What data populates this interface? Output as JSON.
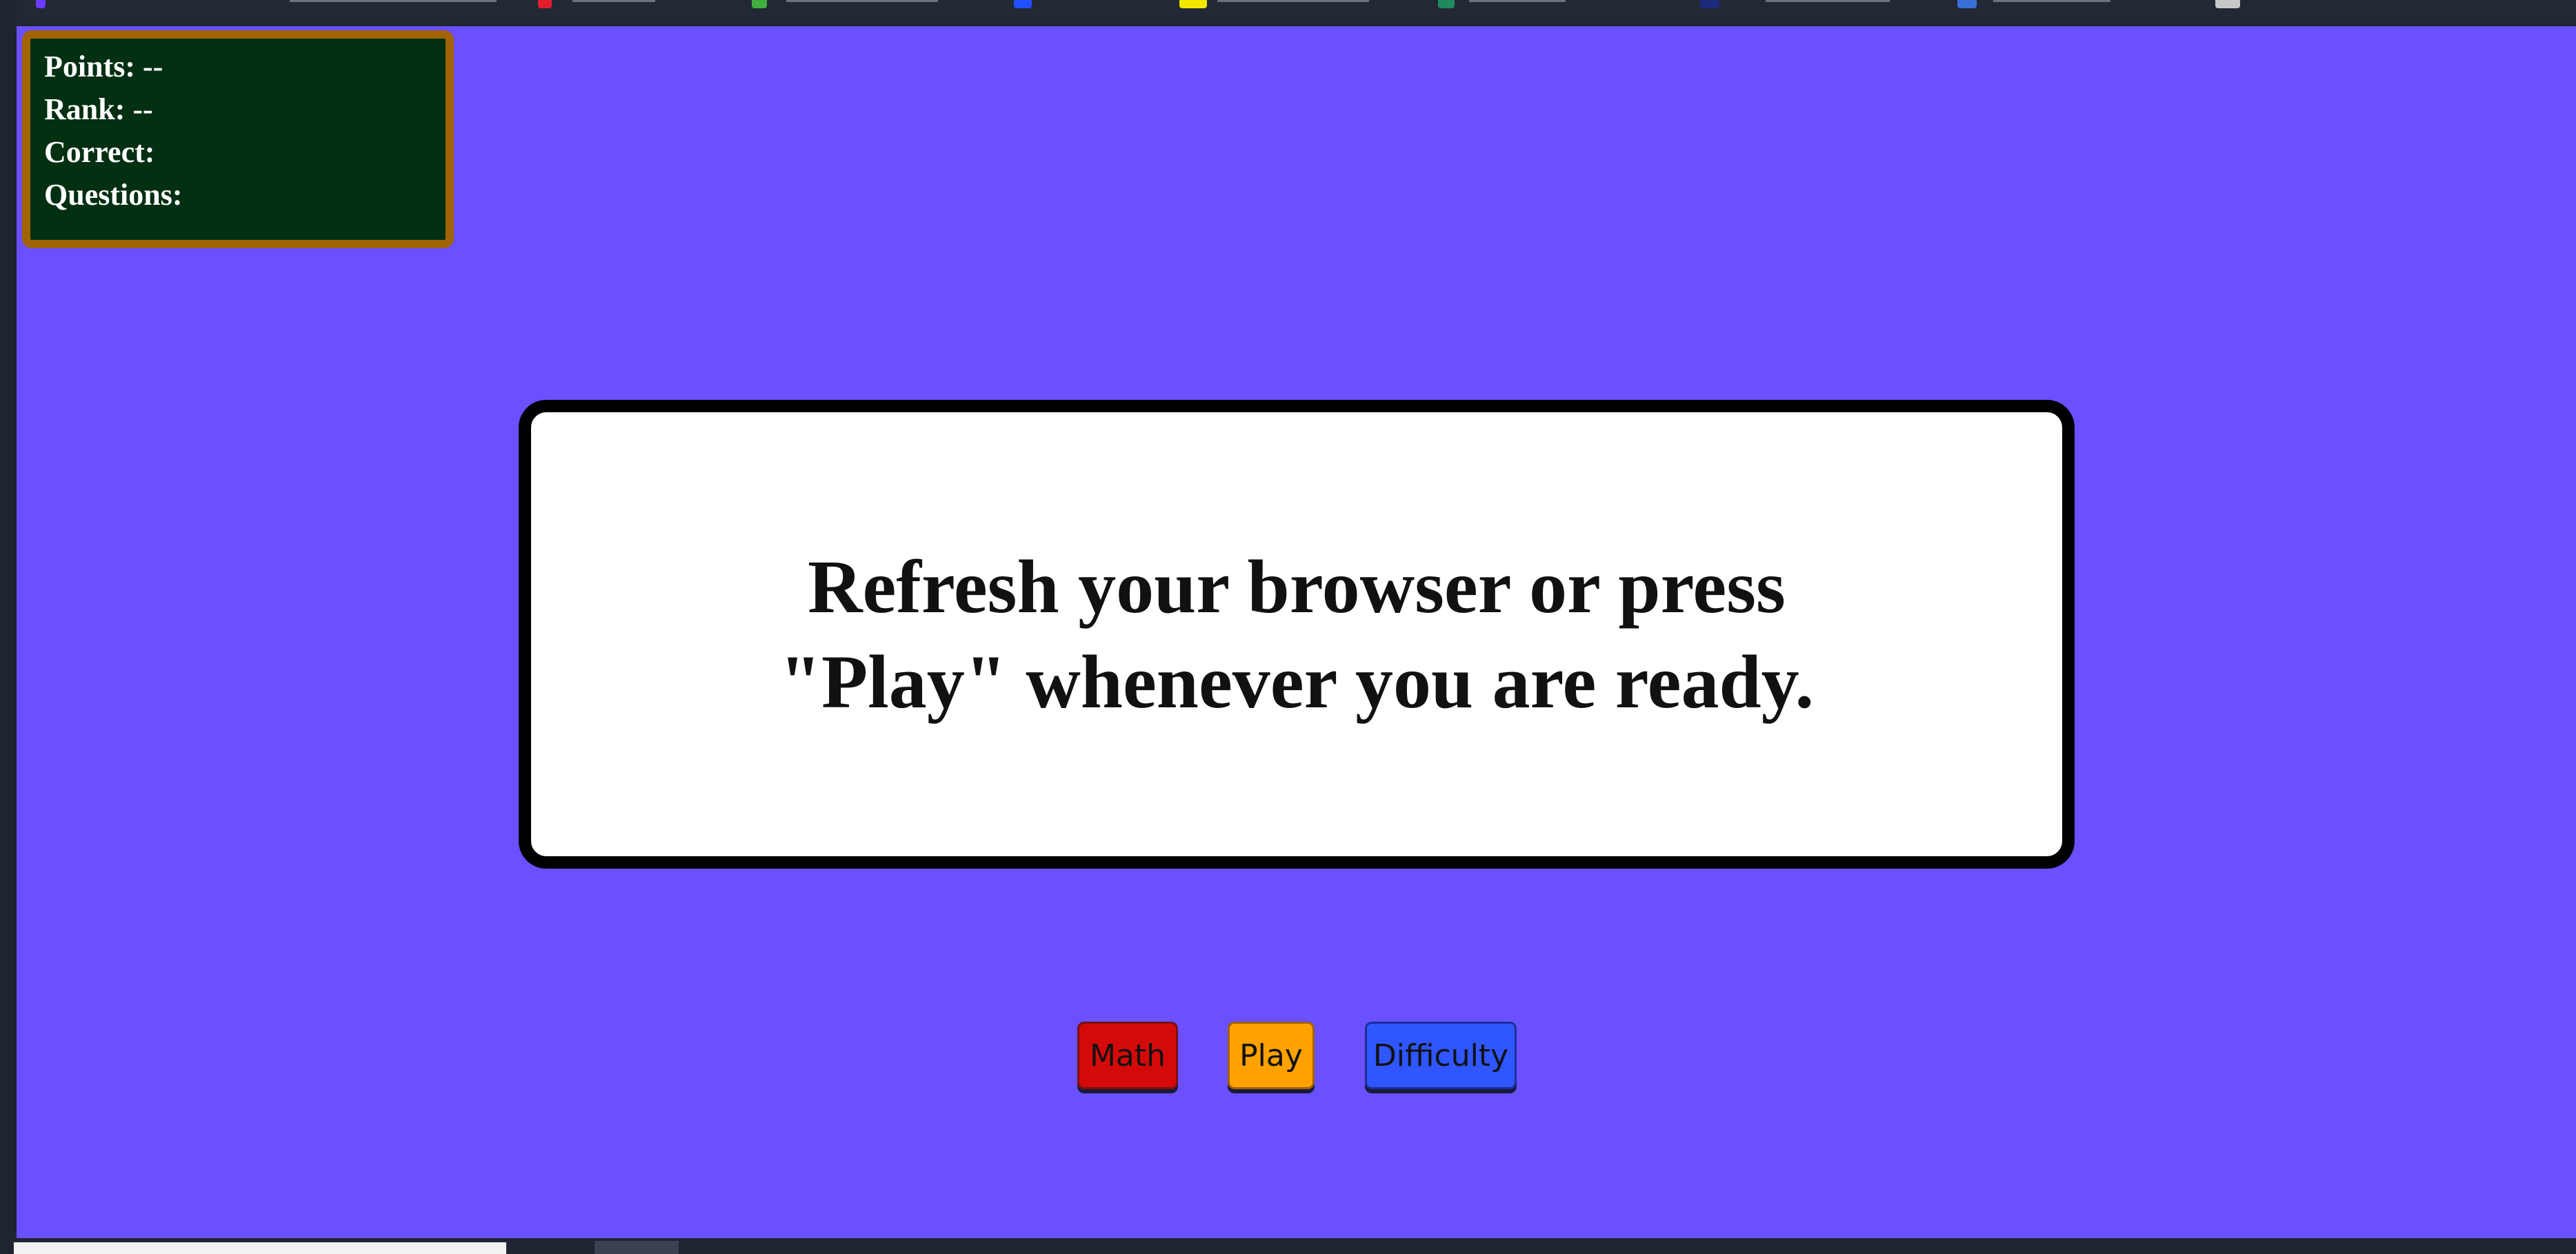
{
  "colors": {
    "stage_background": "#6a50ff",
    "score_panel_background": "#032f12",
    "score_panel_border": "#a26306",
    "math_button": "#d40a0a",
    "play_button": "#ffa100",
    "difficulty_button": "#2f56ff"
  },
  "score_panel": {
    "points_label": "Points: --",
    "rank_label": "Rank: --",
    "correct_label": "Correct:",
    "questions_label": "Questions:"
  },
  "message": {
    "text": "Refresh your browser or press \"Play\" whenever you are ready."
  },
  "controls": {
    "math_label": "Math",
    "play_label": "Play",
    "difficulty_label": "Difficulty"
  }
}
